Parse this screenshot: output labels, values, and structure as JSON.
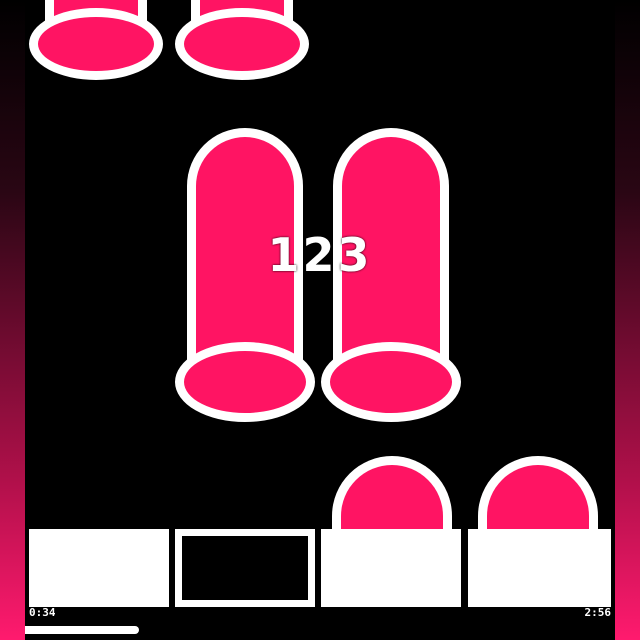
{
  "game": {
    "combo": "123",
    "elapsed_time": "0:34",
    "total_time": "2:56",
    "progress_fraction": 0.1932,
    "lanes": 4,
    "note_color": "#ff1463",
    "outline_color": "#ffffff",
    "pads": [
      {
        "lane": 1,
        "state": "filled"
      },
      {
        "lane": 2,
        "state": "outline"
      },
      {
        "lane": 3,
        "state": "filled"
      },
      {
        "lane": 4,
        "state": "filled"
      }
    ]
  }
}
